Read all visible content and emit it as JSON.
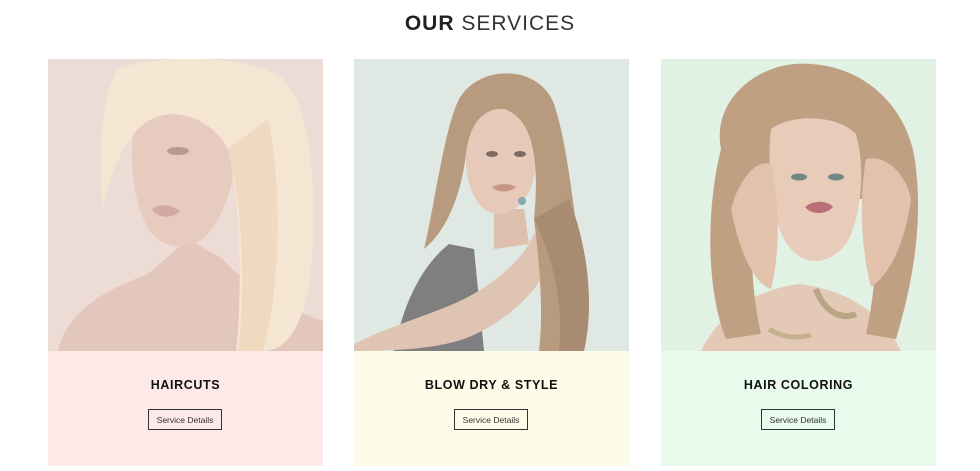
{
  "section": {
    "title_bold": "OUR",
    "title_light": "SERVICES"
  },
  "services": [
    {
      "title": "HAIRCUTS",
      "button": "Service Details",
      "panel_color": "#fde9e8",
      "photo_bg": "#ecd9d2"
    },
    {
      "title": "BLOW DRY & STYLE",
      "button": "Service Details",
      "panel_color": "#fdfce9",
      "photo_bg": "#dfe8e2"
    },
    {
      "title": "HAIR COLORING",
      "button": "Service Details",
      "panel_color": "#e8fbec",
      "photo_bg": "#e1f1e4"
    }
  ]
}
